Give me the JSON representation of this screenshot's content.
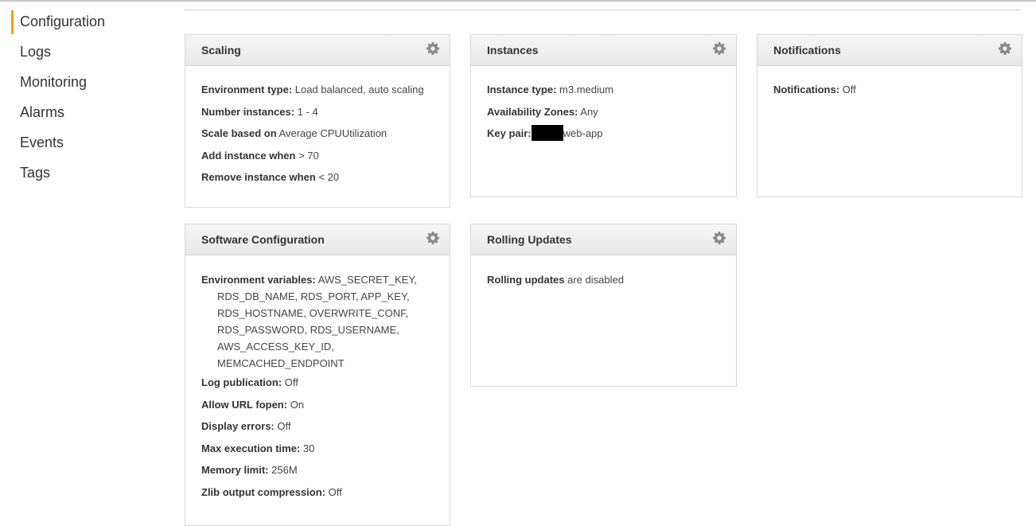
{
  "sidebar": {
    "items": [
      {
        "label": "Configuration",
        "active": true
      },
      {
        "label": "Logs"
      },
      {
        "label": "Monitoring"
      },
      {
        "label": "Alarms"
      },
      {
        "label": "Events"
      },
      {
        "label": "Tags"
      }
    ]
  },
  "colors": {
    "accent": "#f39c12",
    "header_bg": "#ececec",
    "border": "#d8d8d8"
  },
  "icons": {
    "panel_settings": "gear-icon"
  },
  "panels": {
    "scaling": {
      "title": "Scaling",
      "rows": [
        {
          "label": "Environment type:",
          "value": " Load balanced, auto scaling"
        },
        {
          "label": "Number instances:",
          "value": " 1 - 4"
        },
        {
          "label": "Scale based on",
          "value": " Average CPUUtilization"
        },
        {
          "label": "Add instance when",
          "value": " > 70"
        },
        {
          "label": "Remove instance when",
          "value": " < 20"
        }
      ]
    },
    "instances": {
      "title": "Instances",
      "rows": [
        {
          "label": "Instance type:",
          "value": " m3.medium"
        },
        {
          "label": "Availability Zones:",
          "value": " Any"
        },
        {
          "label": "Key pair:",
          "value": "web-app"
        }
      ]
    },
    "notifications": {
      "title": "Notifications",
      "rows": [
        {
          "label": "Notifications:",
          "value": " Off"
        }
      ]
    },
    "software": {
      "title": "Software Configuration",
      "env_label": "Environment variables:",
      "env_lines": [
        "AWS_SECRET_KEY,",
        "RDS_DB_NAME, RDS_PORT, APP_KEY,",
        "RDS_HOSTNAME, OVERWRITE_CONF,",
        "RDS_PASSWORD, RDS_USERNAME,",
        "AWS_ACCESS_KEY_ID,",
        "MEMCACHED_ENDPOINT"
      ],
      "rows": [
        {
          "label": "Log publication:",
          "value": " Off"
        },
        {
          "label": "Allow URL fopen:",
          "value": " On"
        },
        {
          "label": "Display errors:",
          "value": " Off"
        },
        {
          "label": "Max execution time:",
          "value": " 30"
        },
        {
          "label": "Memory limit:",
          "value": " 256M"
        },
        {
          "label": "Zlib output compression:",
          "value": " Off"
        }
      ]
    },
    "rolling": {
      "title": "Rolling Updates",
      "label": "Rolling updates",
      "value": " are disabled"
    }
  }
}
